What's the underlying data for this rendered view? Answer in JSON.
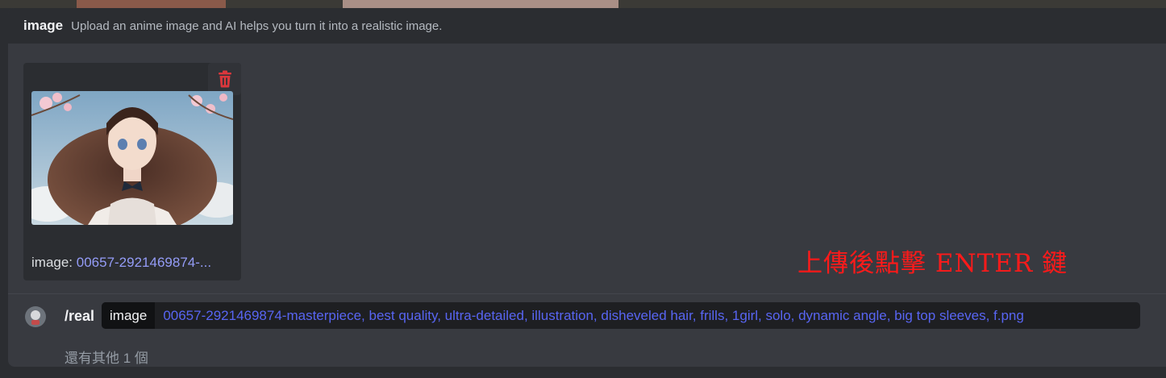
{
  "option_hint": {
    "name": "image",
    "description": "Upload an anime image and AI helps you turn it into a realistic image."
  },
  "attachment": {
    "caption_label": "image: ",
    "caption_filename": "00657-2921469874-...",
    "delete_icon": "trash-icon"
  },
  "annotation": {
    "text": "上傳後點擊 ENTER 鍵",
    "color": "#ff1a1a"
  },
  "command": {
    "name": "/real",
    "option_key": "image",
    "option_value": "00657-2921469874-masterpiece, best quality, ultra-detailed, illustration, disheveled hair, frills, 1girl, solo, dynamic angle, big top sleeves, f.png",
    "more_options": "還有其他 1 個"
  },
  "colors": {
    "accent": "#5865f2",
    "link": "#949cf7",
    "danger": "#da373c"
  }
}
